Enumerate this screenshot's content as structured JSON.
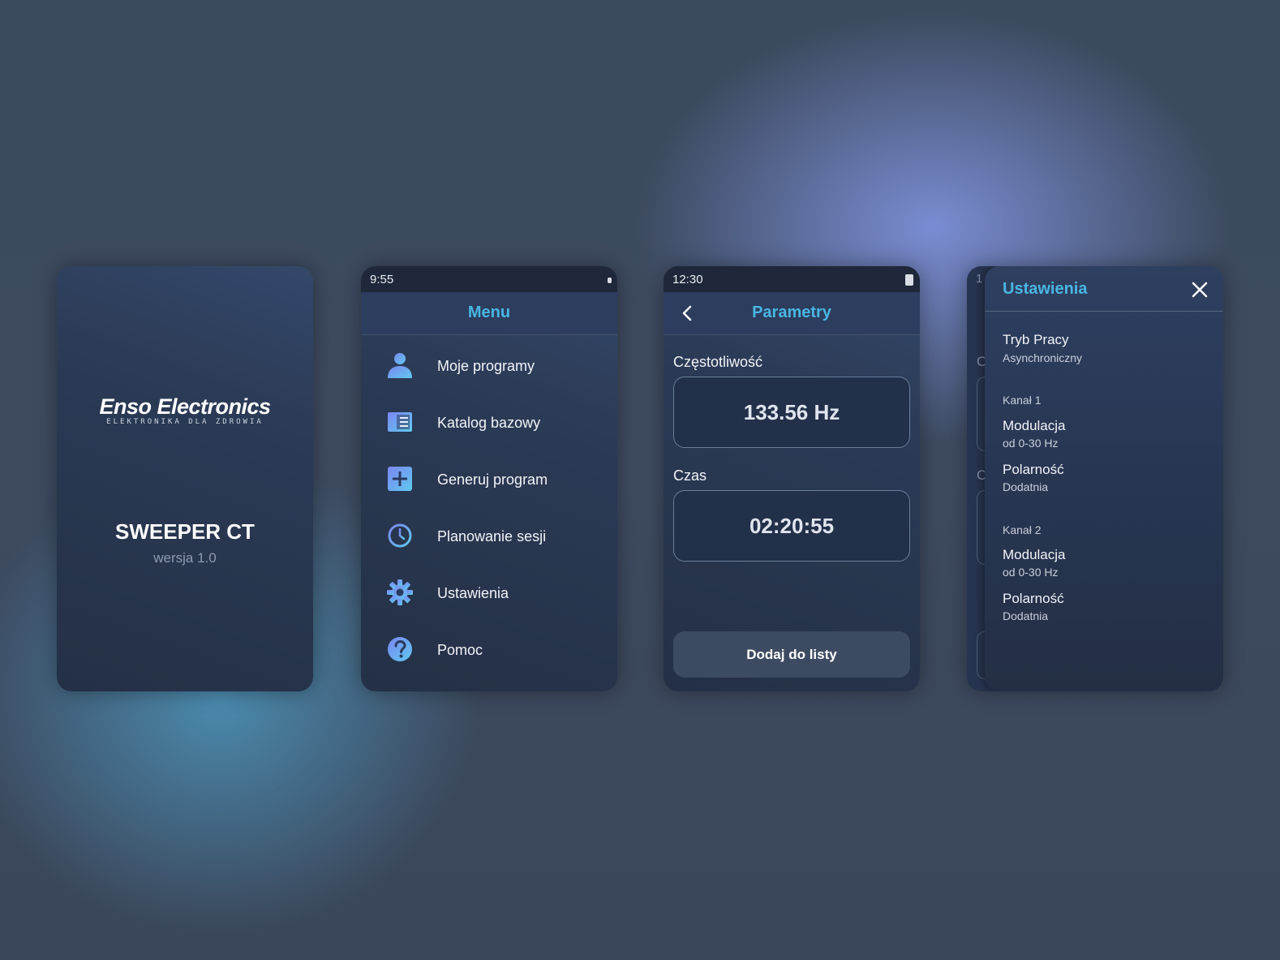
{
  "splash": {
    "logo_name": "Enso Electronics",
    "logo_tagline": "ELEKTRONIKA DLA ZDROWIA",
    "title": "SWEEPER CT",
    "version": "wersja 1.0"
  },
  "menu_screen": {
    "time": "9:55",
    "header": "Menu",
    "items": [
      {
        "label": "Moje programy",
        "icon": "user-icon"
      },
      {
        "label": "Katalog bazowy",
        "icon": "catalog-icon"
      },
      {
        "label": "Generuj program",
        "icon": "plus-icon"
      },
      {
        "label": "Planowanie sesji",
        "icon": "clock-icon"
      },
      {
        "label": "Ustawienia",
        "icon": "gear-icon"
      },
      {
        "label": "Pomoc",
        "icon": "help-icon"
      }
    ]
  },
  "params_screen": {
    "time": "12:30",
    "header": "Parametry",
    "frequency_label": "Częstotliwość",
    "frequency_value": "133.56 Hz",
    "time_label": "Czas",
    "time_value": "02:20:55",
    "add_button": "Dodaj do listy"
  },
  "settings_screen": {
    "peek_time": "1",
    "peek_label": "C",
    "title": "Ustawienia",
    "mode_title": "Tryb Pracy",
    "mode_value": "Asynchroniczny",
    "channel1": {
      "name": "Kanał 1",
      "modulation_title": "Modulacja",
      "modulation_value": "od 0-30 Hz",
      "polarity_title": "Polarność",
      "polarity_value": "Dodatnia"
    },
    "channel2": {
      "name": "Kanał 2",
      "modulation_title": "Modulacja",
      "modulation_value": "od 0-30 Hz",
      "polarity_title": "Polarność",
      "polarity_value": "Dodatnia"
    }
  },
  "colors": {
    "accent": "#49b6e2",
    "icon_gradient_start": "#6f8ef0",
    "icon_gradient_end": "#6cc6ef"
  }
}
